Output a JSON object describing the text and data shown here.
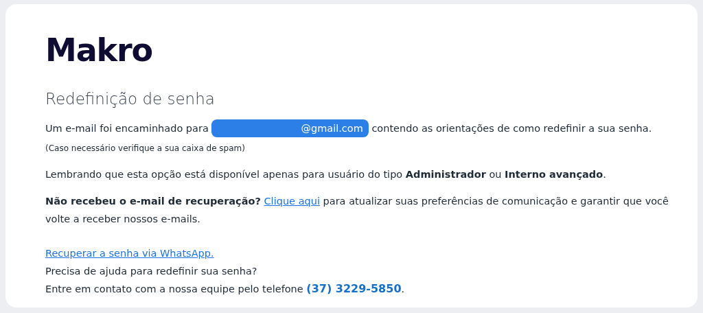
{
  "logo": {
    "text": "Makro"
  },
  "title": "Redefinição de senha",
  "email_notice": {
    "before": "Um e-mail foi encaminhado para",
    "email": "@gmail.com",
    "after": "contendo as orientações de como redefinir a sua senha.",
    "note": "(Caso necessário verifique a sua caixa de spam)"
  },
  "user_type_notice": "Lembrando que esta opção está disponível apenas para usuário do tipo **Administrador** ou **Interno avançado**.",
  "resend_notice": {
    "question": "Não recebeu o e-mail de recuperação?",
    "link": "Clique aqui",
    "after": "para atualizar suas preferências de comunicação e garantir que você volte a receber nossos e-mails."
  },
  "whatsapp_link": "Recuperar a senha via WhatsApp.",
  "help_text": "Precisa de ajuda para redefinir sua senha?",
  "contact": {
    "text": "Entre em contato com a nossa equipe pelo telefone",
    "phone": "(37) 3229-5850",
    "end": "."
  }
}
